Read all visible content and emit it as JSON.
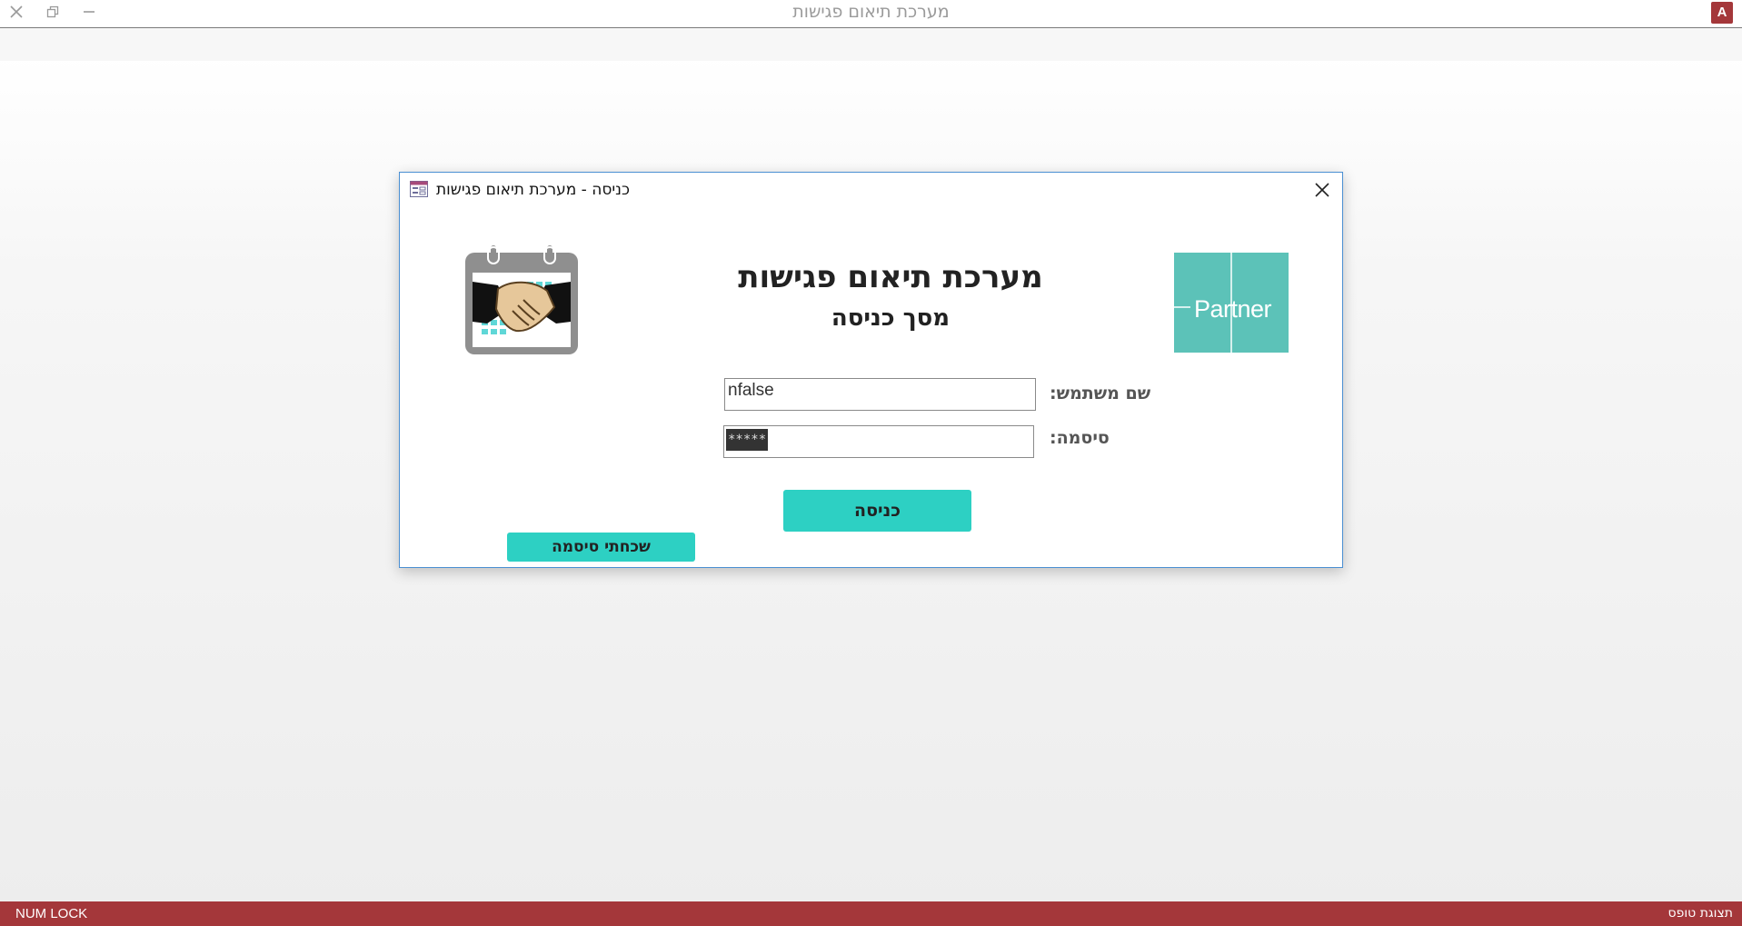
{
  "window": {
    "title": "מערכת תיאום פגישות",
    "app_icon_label": "A",
    "controls": [
      "close",
      "restore",
      "minimize"
    ]
  },
  "dialog": {
    "title": "כניסה - מערכת תיאום פגישות",
    "main_title": "מערכת תיאום פגישות",
    "sub_title": "מסך כניסה",
    "logo_text": "Partner",
    "username_label": "שם משתמש:",
    "username_value": "nfalse",
    "password_label": "סיסמה:",
    "password_mask": "*****",
    "login_button": "כניסה",
    "forgot_button": "שכחתי סיסמה",
    "colors": {
      "accent": "#2dd0c3",
      "logo": "#5cc2b8",
      "border": "#4a8fd2"
    }
  },
  "statusbar": {
    "left": "NUM LOCK",
    "right": "תצוגת טופס",
    "color": "#a4373a"
  }
}
